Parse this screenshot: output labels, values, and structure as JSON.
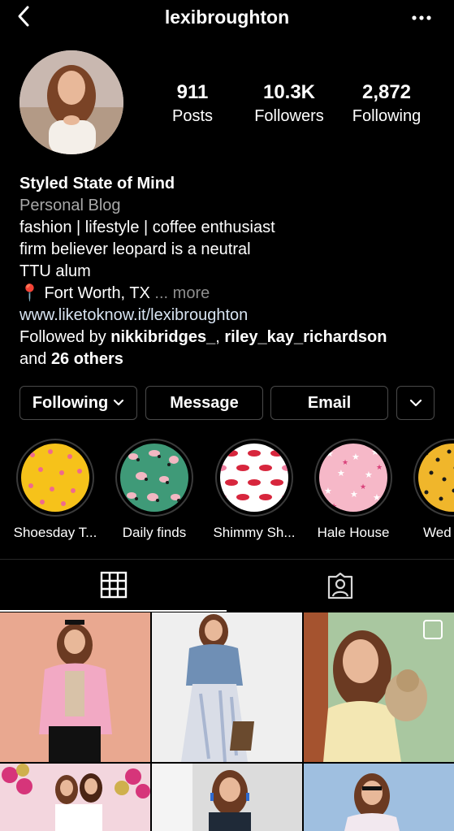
{
  "header": {
    "username": "lexibroughton",
    "back_icon": "chevron-left-icon",
    "menu_icon": "more-dots-icon"
  },
  "stats": {
    "posts": {
      "value": "911",
      "label": "Posts"
    },
    "followers": {
      "value": "10.3K",
      "label": "Followers"
    },
    "following": {
      "value": "2,872",
      "label": "Following"
    }
  },
  "bio": {
    "name": "Styled State of Mind",
    "category": "Personal Blog",
    "lines": [
      "fashion | lifestyle | coffee enthusiast",
      "firm believer leopard is a neutral",
      "TTU alum"
    ],
    "location_pin": "📍",
    "location": "Fort Worth, TX",
    "more": " ... more",
    "link": "www.liketoknow.it/lexibroughton",
    "followed_by_prefix": "Followed by ",
    "followed_user_1": "nikkibridges_",
    "separator": ", ",
    "followed_user_2": "riley_kay_richardson",
    "and_text": "and ",
    "others": "26 others"
  },
  "buttons": {
    "following": "Following",
    "message": "Message",
    "email": "Email"
  },
  "highlights": [
    {
      "title": "Shoesday T..."
    },
    {
      "title": "Daily finds"
    },
    {
      "title": "Shimmy Sh..."
    },
    {
      "title": "Hale House"
    },
    {
      "title": "Wed"
    }
  ],
  "tabs": {
    "grid_icon": "grid-icon",
    "tagged_icon": "tagged-person-icon",
    "active": "grid"
  },
  "colors": {
    "background": "#000000",
    "link": "#d8e4f2",
    "secondary_text": "#a8a8a8",
    "button_border": "#4a4a4a"
  }
}
